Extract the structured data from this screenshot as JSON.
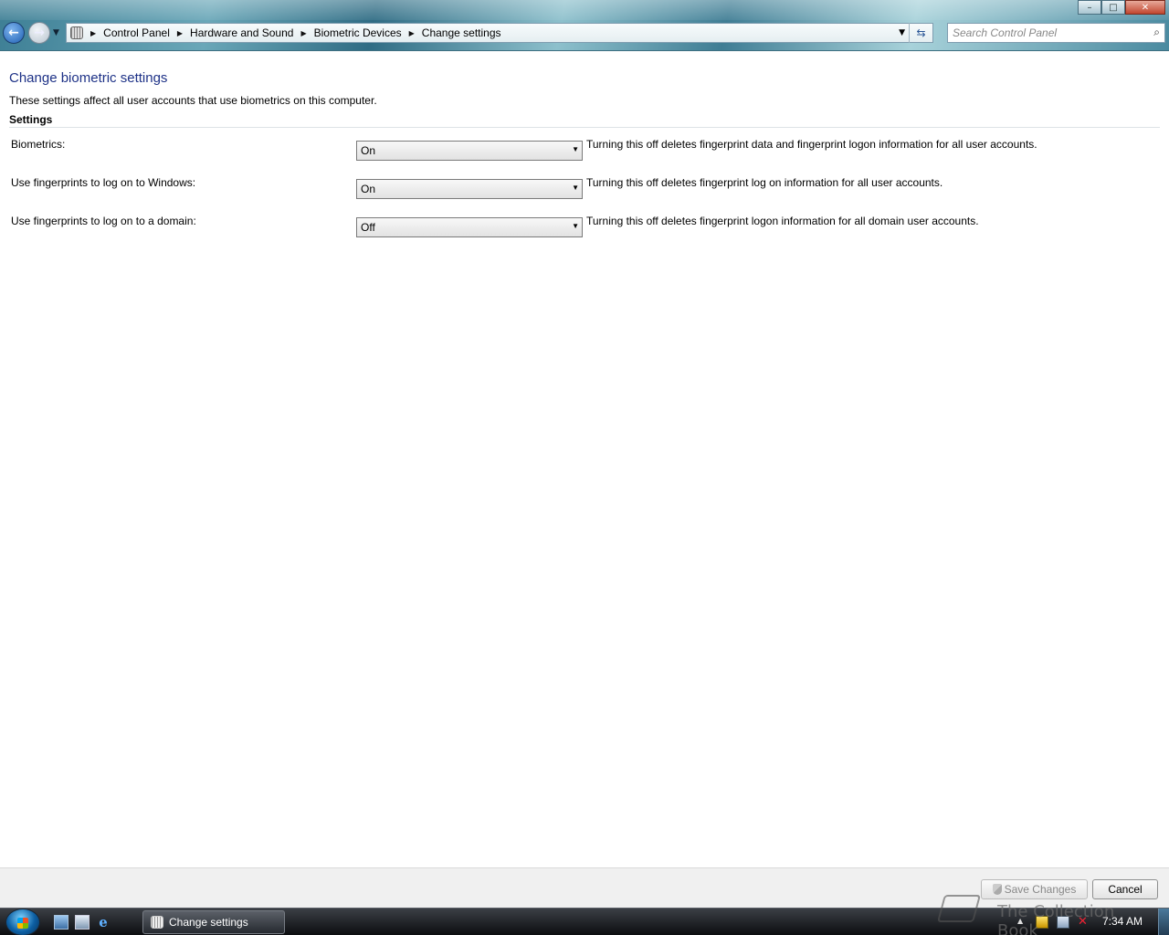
{
  "window": {
    "buttons": {
      "minimize": "–",
      "maximize": "□",
      "close": "✕"
    }
  },
  "nav": {
    "back_icon": "left-arrow",
    "forward_icon": "right-arrow",
    "back_glyph": "←",
    "forward_glyph": "→"
  },
  "address": {
    "breadcrumbs": [
      "Control Panel",
      "Hardware and Sound",
      "Biometric Devices",
      "Change settings"
    ]
  },
  "search": {
    "placeholder": "Search Control Panel"
  },
  "page": {
    "title": "Change biometric settings",
    "description": "These settings affect all user accounts that use biometrics on this computer.",
    "section_header": "Settings"
  },
  "settings": [
    {
      "label": "Biometrics:",
      "value": "On",
      "note": "Turning this off deletes fingerprint data and fingerprint logon information for all user accounts."
    },
    {
      "label": "Use fingerprints to log on to Windows:",
      "value": "On",
      "note": "Turning this off deletes fingerprint log on information for all user accounts."
    },
    {
      "label": "Use fingerprints to log on to a domain:",
      "value": "Off",
      "note": "Turning this off deletes fingerprint logon information for all domain user accounts."
    }
  ],
  "footer": {
    "save_label": "Save Changes",
    "cancel_label": "Cancel"
  },
  "taskbar": {
    "active_window": "Change settings",
    "clock": "7:34 AM"
  },
  "watermark": {
    "text": "The Collection Book"
  },
  "colors": {
    "title_blue": "#1e3287"
  }
}
